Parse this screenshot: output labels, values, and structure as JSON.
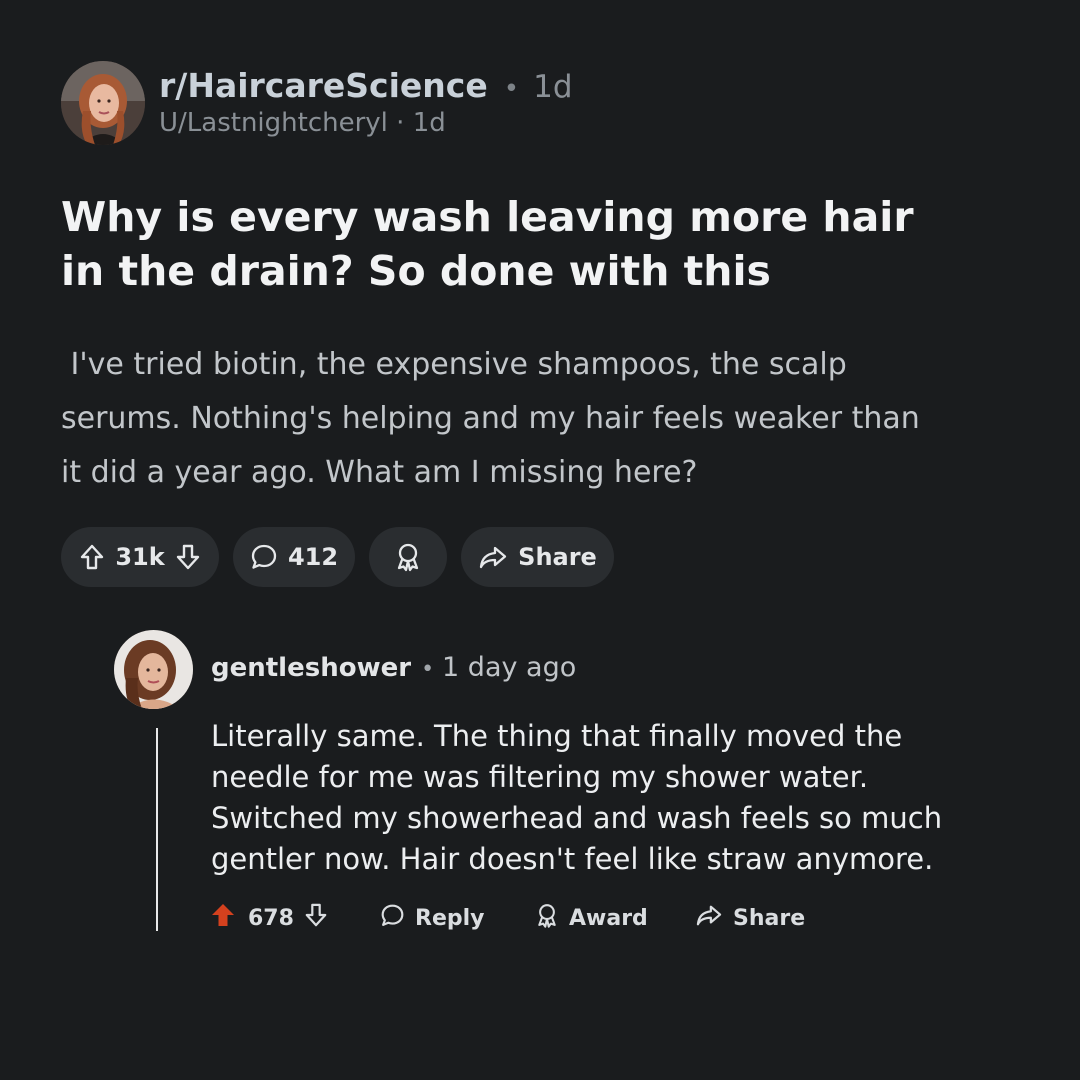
{
  "post": {
    "subreddit": "r/HaircareScience",
    "separator": "•",
    "age": "1d",
    "username_line": "U/Lastnightcheryl · 1d",
    "title": "Why is every wash leaving more hair in the drain? So done with this",
    "body": " I've tried biotin, the expensive shampoos, the scalp serums. Nothing's helping and my hair feels weaker than it did a year ago. What am I missing here?",
    "actions": {
      "score": "31k",
      "comments": "412",
      "share_label": "Share"
    }
  },
  "comment": {
    "username": "gentleshower",
    "separator": "•",
    "age": "1 day ago",
    "body": "Literally same. The thing that finally moved the needle for me was filtering my shower water. Switched my showerhead and wash feels so much gentler now. Hair doesn't feel like straw anymore.",
    "actions": {
      "score": "678",
      "reply_label": "Reply",
      "award_label": "Award",
      "share_label": "Share"
    }
  },
  "colors": {
    "background": "#1a1c1e",
    "pill": "#2a2d30",
    "upvoted": "#d4411e"
  },
  "icons": [
    "upvote-arrow-icon",
    "downvote-arrow-icon",
    "comment-bubble-icon",
    "award-ribbon-icon",
    "share-arrow-icon"
  ]
}
